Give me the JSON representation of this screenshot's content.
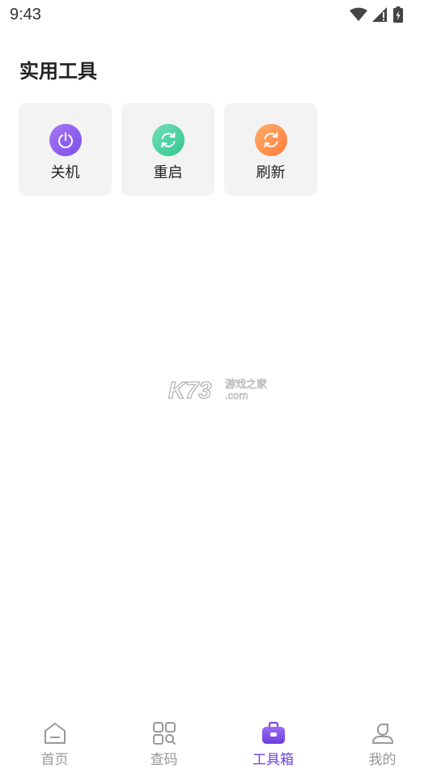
{
  "status_bar": {
    "time": "9:43"
  },
  "section": {
    "title": "实用工具"
  },
  "tools": [
    {
      "label": "关机",
      "icon": "power-icon",
      "color": "#8b5cf0"
    },
    {
      "label": "重启",
      "icon": "refresh-icon",
      "color": "#3cc894"
    },
    {
      "label": "刷新",
      "icon": "refresh-icon",
      "color": "#ff8a45"
    }
  ],
  "watermark": {
    "brand": "K73",
    "site_name": "游戏之家",
    "domain": ".com"
  },
  "tabbar": {
    "active_color": "#6a3fe0",
    "inactive_color": "#999999",
    "items": [
      {
        "label": "首页",
        "icon": "home-icon"
      },
      {
        "label": "查码",
        "icon": "grid-search-icon"
      },
      {
        "label": "工具箱",
        "icon": "toolbox-icon",
        "active": true
      },
      {
        "label": "我的",
        "icon": "user-icon"
      }
    ]
  }
}
